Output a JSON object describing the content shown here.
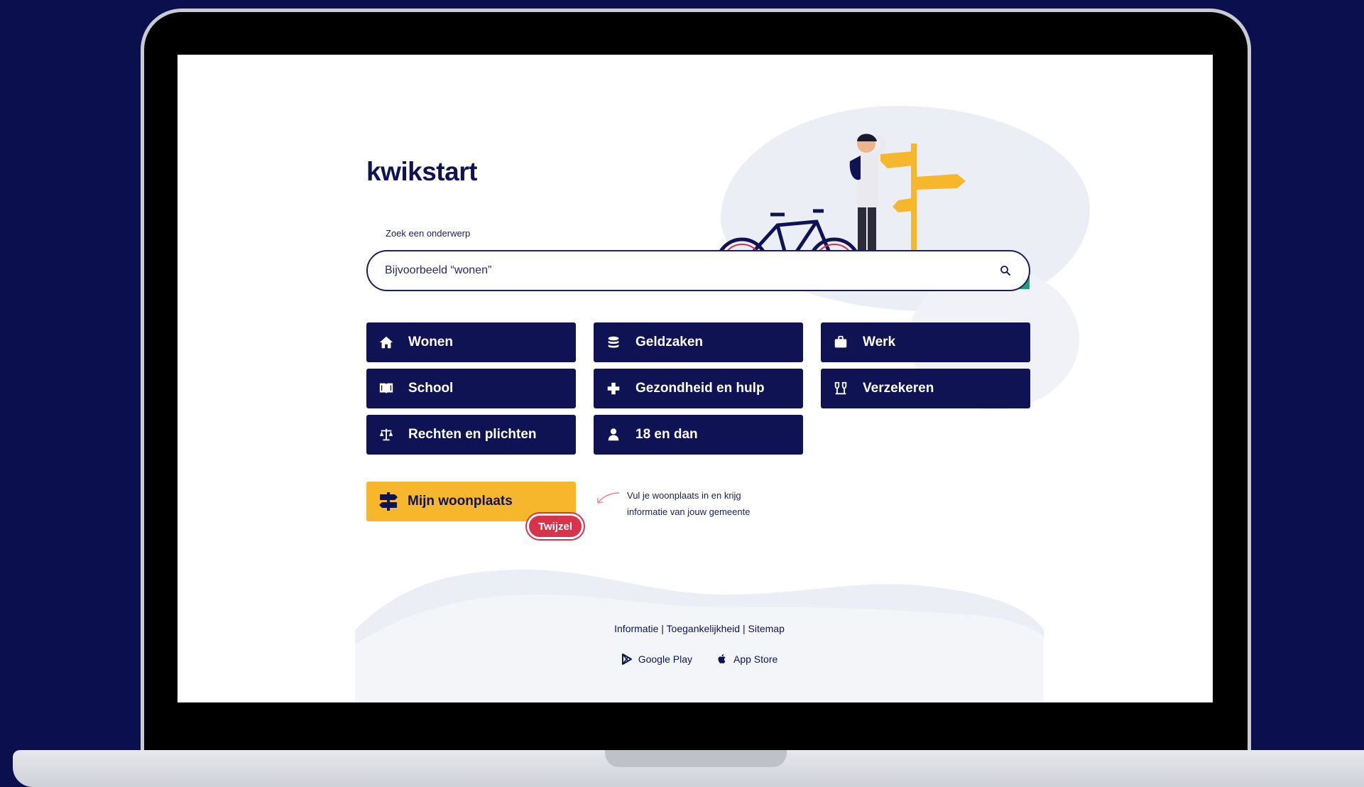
{
  "app": {
    "logo": "kwikstart"
  },
  "search": {
    "label": "Zoek een onderwerp",
    "placeholder": "Bijvoorbeeld “wonen”"
  },
  "categories": [
    {
      "label": "Wonen",
      "icon": "home-icon"
    },
    {
      "label": "Geldzaken",
      "icon": "coins-icon"
    },
    {
      "label": "Werk",
      "icon": "briefcase-icon"
    },
    {
      "label": "School",
      "icon": "book-icon"
    },
    {
      "label": "Gezondheid en hulp",
      "icon": "plus-icon"
    },
    {
      "label": "Verzekeren",
      "icon": "umbrella-icon"
    },
    {
      "label": "Rechten en plichten",
      "icon": "scale-icon"
    },
    {
      "label": "18 en dan",
      "icon": "person-icon"
    }
  ],
  "location": {
    "button_label": "Mijn woonplaats",
    "badge": "Twijzel",
    "hint": "Vul je woonplaats in en krijg informatie van jouw gemeente"
  },
  "footer": {
    "links": [
      "Informatie",
      "Toegankelijkheid",
      "Sitemap"
    ],
    "separator": "|",
    "stores": [
      "Google Play",
      "App Store"
    ]
  },
  "colors": {
    "navy": "#0f1353",
    "background": "#0b0f4d",
    "accent_yellow": "#f7b72c",
    "badge_red": "#d8334a"
  }
}
